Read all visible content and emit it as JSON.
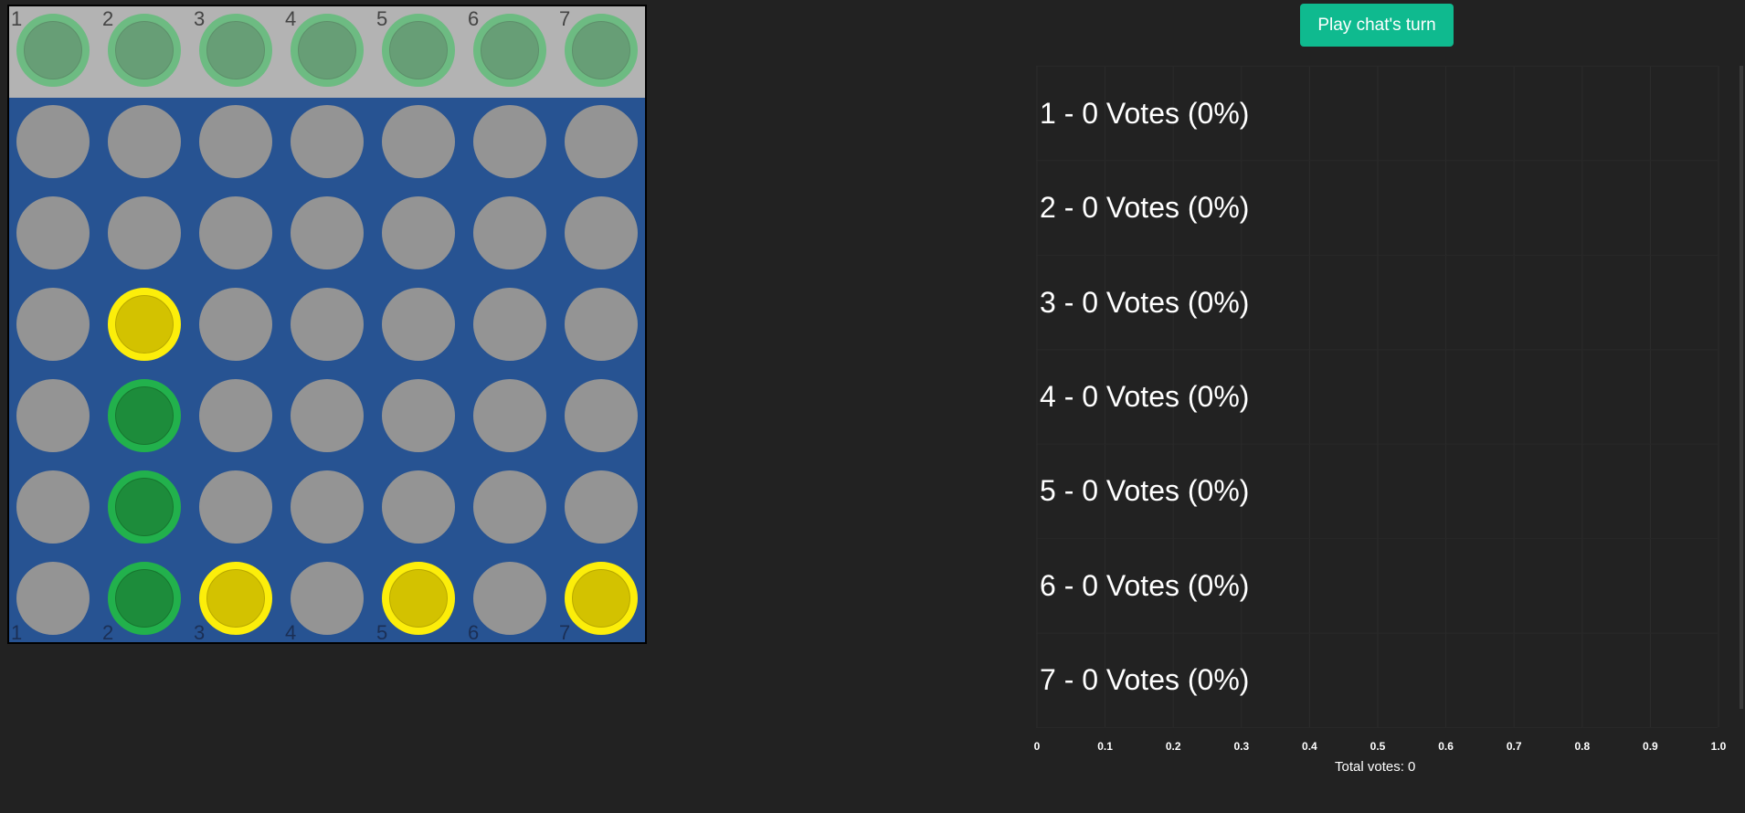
{
  "play_button": {
    "label": "Play chat's turn"
  },
  "board": {
    "columns": [
      "1",
      "2",
      "3",
      "4",
      "5",
      "6",
      "7"
    ],
    "preview_row": [
      "preview",
      "preview",
      "preview",
      "preview",
      "preview",
      "preview",
      "preview"
    ],
    "grid": [
      [
        "empty",
        "empty",
        "empty",
        "empty",
        "empty",
        "empty",
        "empty"
      ],
      [
        "empty",
        "empty",
        "empty",
        "empty",
        "empty",
        "empty",
        "empty"
      ],
      [
        "empty",
        "yellow",
        "empty",
        "empty",
        "empty",
        "empty",
        "empty"
      ],
      [
        "empty",
        "green",
        "empty",
        "empty",
        "empty",
        "empty",
        "empty"
      ],
      [
        "empty",
        "green",
        "empty",
        "empty",
        "empty",
        "empty",
        "empty"
      ],
      [
        "empty",
        "green",
        "yellow",
        "empty",
        "yellow",
        "empty",
        "yellow"
      ]
    ],
    "colors": {
      "board": "#275392",
      "drop_zone": "#b3b3b3",
      "empty": "#949494",
      "yellow": "#d3c200",
      "green": "#1d8c3b"
    }
  },
  "votes": {
    "rows": [
      {
        "label": "1 - 0 Votes (0%)"
      },
      {
        "label": "2 - 0 Votes (0%)"
      },
      {
        "label": "3 - 0 Votes (0%)"
      },
      {
        "label": "4 - 0 Votes (0%)"
      },
      {
        "label": "5 - 0 Votes (0%)"
      },
      {
        "label": "6 - 0 Votes (0%)"
      },
      {
        "label": "7 - 0 Votes (0%)"
      }
    ],
    "total_label": "Total votes: 0"
  },
  "chart_data": {
    "type": "bar",
    "orientation": "horizontal",
    "categories": [
      "1",
      "2",
      "3",
      "4",
      "5",
      "6",
      "7"
    ],
    "values": [
      0,
      0,
      0,
      0,
      0,
      0,
      0
    ],
    "xlim": [
      0,
      1.0
    ],
    "x_ticks": [
      "0",
      "0.1",
      "0.2",
      "0.3",
      "0.4",
      "0.5",
      "0.6",
      "0.7",
      "0.8",
      "0.9",
      "1.0"
    ],
    "grid": true
  }
}
